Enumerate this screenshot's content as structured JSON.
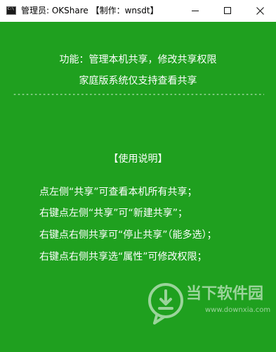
{
  "window": {
    "title": "管理员:  OKShare  【制作：wnsdt】",
    "icon_text": "C:\\",
    "controls": {
      "minimize_icon": "minimize-icon",
      "maximize_icon": "maximize-icon",
      "close_icon": "close-icon"
    },
    "background": "#1fa01f"
  },
  "content": {
    "feature_line": "功能：管理本机共享，修改共享权限",
    "support_line": "家庭版系统仅支持查看共享",
    "divider": "------------------------------------------------------------",
    "usage_heading": "【使用说明】",
    "instructions": [
      "点左侧“共享”可查看本机所有共享；",
      "右键点左侧“共享”可“新建共享”；",
      "右键点右侧共享可“停止共享”（能多选）；",
      "右键点右侧共享选“属性”可修改权限；"
    ]
  },
  "watermark": {
    "text": "当下软件园",
    "url": "www.downxia.com"
  }
}
